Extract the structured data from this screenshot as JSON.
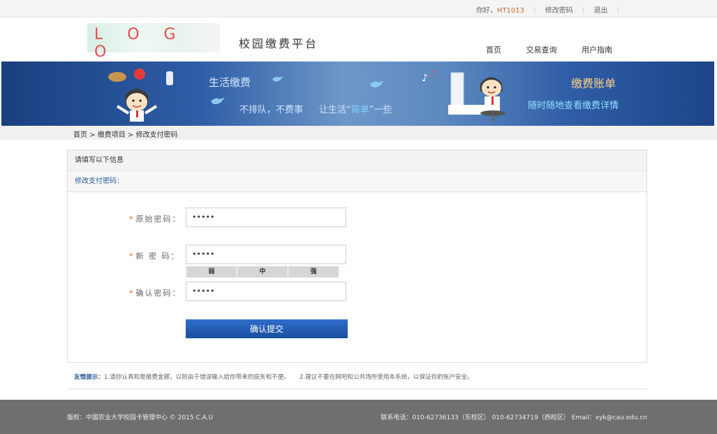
{
  "topbar": {
    "greeting": "你好，",
    "username": "HT1013",
    "change_password": "修改密码",
    "logout": "退出"
  },
  "header": {
    "logo_text": "L O G O",
    "site_title": "校园缴费平台",
    "nav": [
      "首页",
      "交易查询",
      "用户指南"
    ]
  },
  "banner": {
    "line1": "生活缴费",
    "line2": "不排队，不费事",
    "line3_pre": "让生活“",
    "line3_hl": "简单",
    "line3_post": "”一些",
    "right_title": "缴费账单",
    "right_sub": "随时随地查看缴费详情"
  },
  "breadcrumb": "首页 > 缴费项目 > 修改支付密码",
  "panel": {
    "head": "请填写以下信息",
    "sub": "修改支付密码：",
    "fields": [
      {
        "label": "原始密码：",
        "value": "•••••"
      },
      {
        "label": "新  密  码：",
        "value": "•••••"
      },
      {
        "label": "确认密码：",
        "value": "•••••"
      }
    ],
    "strength": [
      "弱",
      "中",
      "强"
    ],
    "submit_label": "确认提交"
  },
  "tips": {
    "label": "友情提示：",
    "t1": "1.请你认真和是缴费金额，以防由于错误输入给你带来的损失和不便。",
    "t2": "2.建议不要在网吧和公共场所使用本系统，以保证你的账户安全。"
  },
  "footer": {
    "left": "版权：中国农业大学校园卡管理中心 © 2015 C.A.U",
    "right": "联系电话：010-62736133（东校区） 010-62734719（西校区） Email：xyk@cau.edu.cn"
  },
  "colors": {
    "accent": "#1a4f9e",
    "star": "#e0632d",
    "username": "#c86a2c",
    "footer_bg": "#6f6f6f"
  }
}
